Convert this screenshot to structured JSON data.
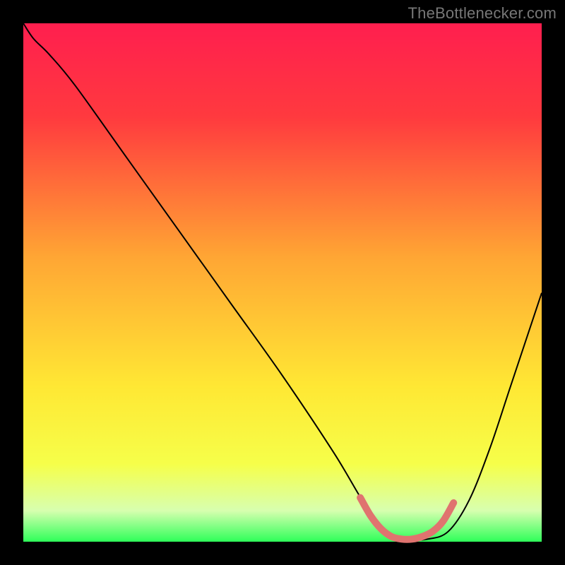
{
  "attribution": "TheBottlenecker.com",
  "chart_data": {
    "type": "line",
    "title": "",
    "xlabel": "",
    "ylabel": "",
    "xlim": [
      0,
      100
    ],
    "ylim": [
      0,
      100
    ],
    "gradient_stops": [
      {
        "pct": 0,
        "color": "#ff1f4f"
      },
      {
        "pct": 18,
        "color": "#ff3a3f"
      },
      {
        "pct": 45,
        "color": "#ffa634"
      },
      {
        "pct": 70,
        "color": "#ffe834"
      },
      {
        "pct": 85,
        "color": "#f6ff4a"
      },
      {
        "pct": 94,
        "color": "#d8ffb0"
      },
      {
        "pct": 100,
        "color": "#2fff5a"
      }
    ],
    "series": [
      {
        "name": "bottleneck-curve",
        "color": "#000000",
        "width": 2,
        "x": [
          0.0,
          2.0,
          5.0,
          10.0,
          20.0,
          30.0,
          40.0,
          50.0,
          60.0,
          66.0,
          70.0,
          74.0,
          78.0,
          82.0,
          86.0,
          90.0,
          94.0,
          100.0
        ],
        "y": [
          100.0,
          97.0,
          94.0,
          88.0,
          74.0,
          60.0,
          46.0,
          32.0,
          17.0,
          7.0,
          2.0,
          0.5,
          0.5,
          2.0,
          8.0,
          18.0,
          30.0,
          48.0
        ]
      },
      {
        "name": "valley-highlight",
        "color": "#e0736f",
        "width": 10,
        "linecap": "round",
        "x": [
          65.0,
          67.0,
          69.0,
          71.0,
          73.0,
          75.0,
          77.0,
          79.0,
          81.0,
          83.0
        ],
        "y": [
          8.5,
          5.0,
          2.5,
          1.0,
          0.5,
          0.5,
          1.0,
          2.0,
          4.0,
          7.5
        ]
      }
    ]
  }
}
